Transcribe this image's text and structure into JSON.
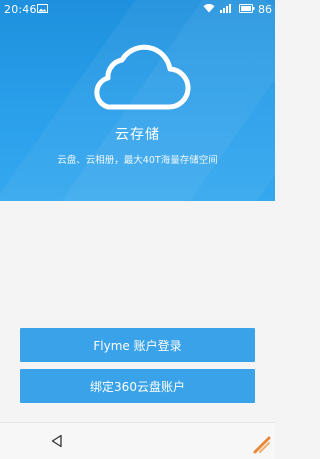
{
  "status_bar": {
    "time": "20:46",
    "battery": "86",
    "icons": [
      "image-icon",
      "wifi-icon",
      "signal-icon",
      "battery-icon"
    ]
  },
  "hero": {
    "icon": "cloud-icon",
    "title": "云存储",
    "subtitle": "云盘、云相册，最大40T海量存储空间"
  },
  "actions": {
    "flyme_login": "Flyme 账户登录",
    "bind_360": "绑定360云盘账户"
  },
  "nav": {
    "back_icon": "back-triangle-icon"
  },
  "colors": {
    "hero_top": "#1e90dd",
    "hero_bottom": "#35a8ef",
    "button": "#3aa2e9",
    "background": "#f4f4f4"
  }
}
